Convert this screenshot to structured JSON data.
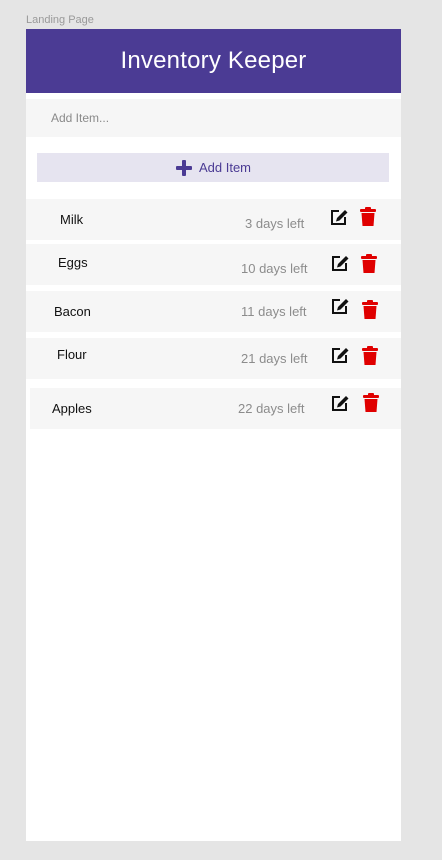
{
  "frame_label": "Landing Page",
  "app": {
    "title": "Inventory Keeper"
  },
  "add_form": {
    "placeholder": "Add Item...",
    "button_label": "Add Item",
    "button_icon": "plus-icon"
  },
  "colors": {
    "header": "#4b3b94",
    "delete": "#e00000",
    "edit": "#111111",
    "button_bg": "#e6e4f0"
  },
  "items": [
    {
      "name": "Milk",
      "days": "3 days left",
      "edit_icon": "edit-icon",
      "delete_icon": "trash-icon"
    },
    {
      "name": "Eggs",
      "days": "10 days left",
      "edit_icon": "edit-icon",
      "delete_icon": "trash-icon"
    },
    {
      "name": "Bacon",
      "days": "11 days left",
      "edit_icon": "edit-icon",
      "delete_icon": "trash-icon"
    },
    {
      "name": "Flour",
      "days": "21 days left",
      "edit_icon": "edit-icon",
      "delete_icon": "trash-icon"
    },
    {
      "name": "Apples",
      "days": "22 days left",
      "edit_icon": "edit-icon",
      "delete_icon": "trash-icon"
    }
  ]
}
